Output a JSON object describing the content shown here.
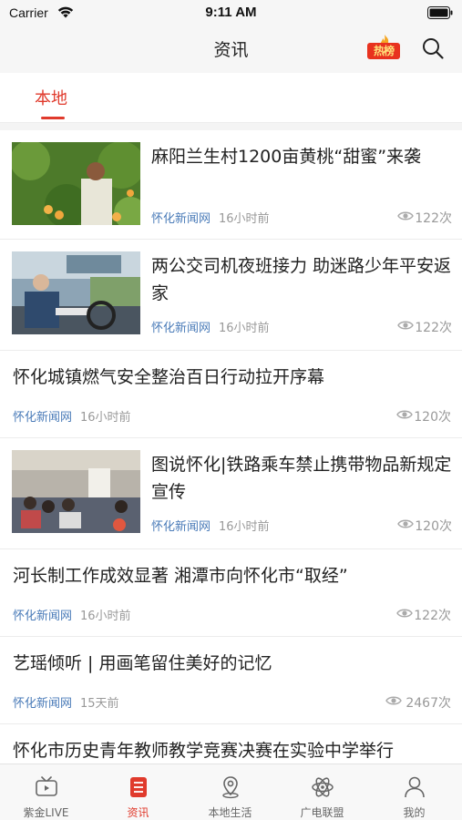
{
  "status_bar": {
    "carrier": "Carrier",
    "time": "9:11 AM"
  },
  "nav": {
    "title": "资讯",
    "hot_badge": "热榜",
    "search_icon": "search-icon"
  },
  "tabs": [
    {
      "label": "本地",
      "active": true
    }
  ],
  "news": [
    {
      "headline": "麻阳兰生村1200亩黄桃“甜蜜”来袭",
      "source": "怀化新闻网",
      "time_ago": "16小时前",
      "views": "122次",
      "has_thumb": true
    },
    {
      "headline": "两公交司机夜班接力 助迷路少年平安返家",
      "source": "怀化新闻网",
      "time_ago": "16小时前",
      "views": "122次",
      "has_thumb": true
    },
    {
      "headline": "怀化城镇燃气安全整治百日行动拉开序幕",
      "source": "怀化新闻网",
      "time_ago": "16小时前",
      "views": "120次",
      "has_thumb": false
    },
    {
      "headline": "图说怀化|铁路乘车禁止携带物品新规定宣传",
      "source": "怀化新闻网",
      "time_ago": "16小时前",
      "views": "120次",
      "has_thumb": true
    },
    {
      "headline": "河长制工作成效显著 湘潭市向怀化市“取经”",
      "source": "怀化新闻网",
      "time_ago": "16小时前",
      "views": "122次",
      "has_thumb": false
    },
    {
      "headline": "艺瑶倾听 | 用画笔留住美好的记忆",
      "source": "怀化新闻网",
      "time_ago": "15天前",
      "views": "2467次",
      "has_thumb": false
    },
    {
      "headline": "怀化市历史青年教师教学竞赛决赛在实验中学举行",
      "has_thumb": false
    }
  ],
  "tab_bar": [
    {
      "label": "紫金LIVE",
      "icon": "tv-icon",
      "active": false
    },
    {
      "label": "资讯",
      "icon": "news-icon",
      "active": true
    },
    {
      "label": "本地生活",
      "icon": "location-icon",
      "active": false
    },
    {
      "label": "广电联盟",
      "icon": "atom-icon",
      "active": false
    },
    {
      "label": "我的",
      "icon": "user-icon",
      "active": false
    }
  ],
  "colors": {
    "accent": "#e03a2c",
    "source_link": "#4a7bb8",
    "muted": "#999999"
  }
}
